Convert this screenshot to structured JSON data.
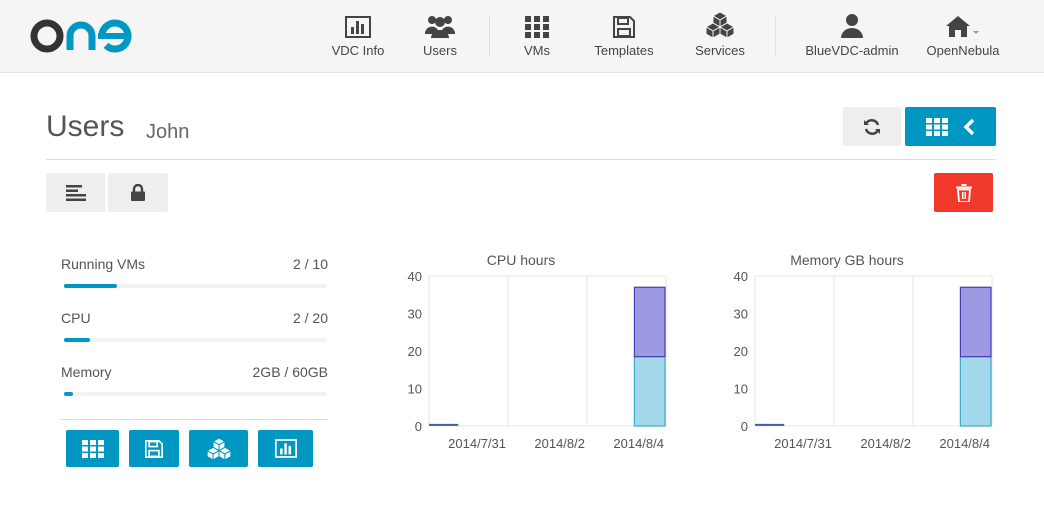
{
  "brand": {
    "logo_text": "one",
    "accent": "#0098c3",
    "dark": "#333333"
  },
  "nav": {
    "items": [
      {
        "label": "VDC Info",
        "icon": "bar-chart-icon"
      },
      {
        "label": "Users",
        "icon": "users-icon"
      },
      {
        "label": "VMs",
        "icon": "grid-icon"
      },
      {
        "label": "Templates",
        "icon": "save-icon"
      },
      {
        "label": "Services",
        "icon": "cubes-icon"
      },
      {
        "label": "BlueVDC-admin",
        "icon": "user-icon"
      },
      {
        "label": "OpenNebula",
        "icon": "home-icon"
      }
    ]
  },
  "page": {
    "title": "Users",
    "subtitle": "John"
  },
  "quotas": [
    {
      "label": "Running VMs",
      "value": "2 / 10",
      "fraction": 0.2
    },
    {
      "label": "CPU",
      "value": "2 / 20",
      "fraction": 0.1
    },
    {
      "label": "Memory",
      "value": "2GB / 60GB",
      "fraction": 0.033
    }
  ],
  "quota_actions": [
    "grid-icon",
    "save-icon",
    "cubes-icon",
    "bar-chart-icon"
  ],
  "chart_data": [
    {
      "type": "bar",
      "title": "CPU hours",
      "categories": [
        "2014/7/31",
        "2014/8/2",
        "2014/8/4"
      ],
      "ylim": [
        0,
        40
      ],
      "yticks": [
        0,
        10,
        20,
        30,
        40
      ],
      "grid": true,
      "series": [
        {
          "color": "#a3d9ea",
          "stroke": "#3fa9c9",
          "date": "2014/8/4",
          "value": 18.5
        },
        {
          "color": "#9d9ae3",
          "stroke": "#4a3bb0",
          "date": "2014/8/4",
          "value": 18.5
        }
      ],
      "baseline_series": {
        "color": "#3a5fb0",
        "date": "2014/7/30",
        "value": 0.3
      }
    },
    {
      "type": "bar",
      "title": "Memory GB hours",
      "categories": [
        "2014/7/31",
        "2014/8/2",
        "2014/8/4"
      ],
      "ylim": [
        0,
        40
      ],
      "yticks": [
        0,
        10,
        20,
        30,
        40
      ],
      "grid": true,
      "series": [
        {
          "color": "#a3d9ea",
          "stroke": "#3fa9c9",
          "date": "2014/8/4",
          "value": 18.5
        },
        {
          "color": "#9d9ae3",
          "stroke": "#4a3bb0",
          "date": "2014/8/4",
          "value": 18.5
        }
      ],
      "baseline_series": {
        "color": "#3a5fb0",
        "date": "2014/7/30",
        "value": 0.3
      }
    }
  ]
}
